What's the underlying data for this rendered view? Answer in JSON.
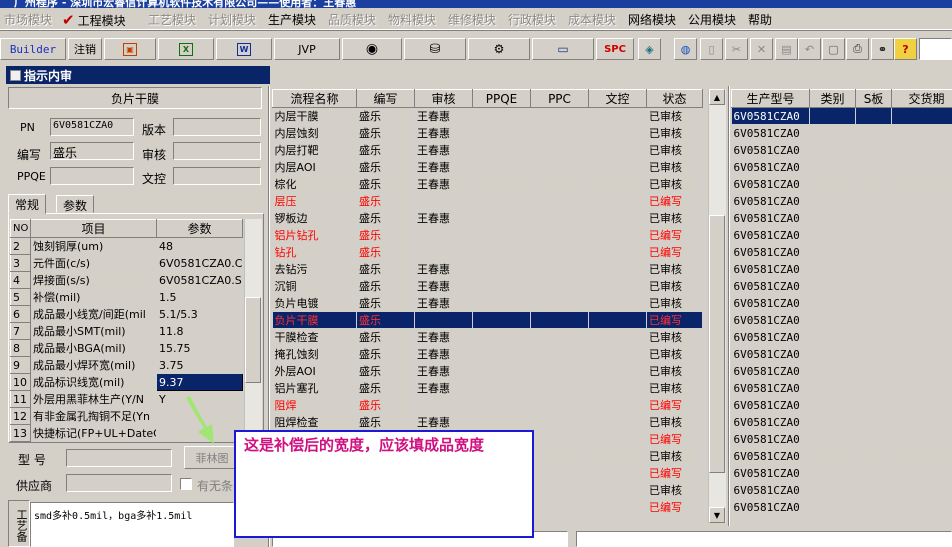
{
  "window": {
    "title": "广州程序 - 深圳市宏睿信计算机软件技术有限公司——使用者：王春惠"
  },
  "menu": [
    {
      "label": "市场模块",
      "enabled": false
    },
    {
      "label": "工程模块",
      "enabled": true,
      "checked": true
    },
    {
      "label": "工艺模块",
      "enabled": false
    },
    {
      "label": "计划模块",
      "enabled": false
    },
    {
      "label": "生产模块",
      "enabled": true
    },
    {
      "label": "品质模块",
      "enabled": false
    },
    {
      "label": "物料模块",
      "enabled": false
    },
    {
      "label": "维修模块",
      "enabled": false
    },
    {
      "label": "行政模块",
      "enabled": false
    },
    {
      "label": "成本模块",
      "enabled": false
    },
    {
      "label": "网络模块",
      "enabled": true
    },
    {
      "label": "公用模块",
      "enabled": true
    },
    {
      "label": "帮助",
      "enabled": true
    }
  ],
  "toolbar": {
    "builder_label": "Builder",
    "logout_label": "注销",
    "jvp_label": "JVP",
    "spc_label": "SPC",
    "icons": [
      "report-icon",
      "excel-icon",
      "word-icon",
      "jvp-icon",
      "eye-icon",
      "database-icon",
      "network-icon",
      "monitor-icon",
      "spc-icon",
      "cube-icon",
      "globe-icon",
      "new-document-icon",
      "cut-icon",
      "delete-icon",
      "save-icon",
      "undo-icon",
      "preview-icon",
      "print-icon",
      "find-icon",
      "help-icon"
    ]
  },
  "panel": {
    "title": "指示内审",
    "process_name": "负片干膜",
    "pn_label": "PN",
    "pn_value": "6V0581CZA0",
    "version_label": "版本",
    "version_value": "",
    "editor_label": "编写",
    "editor_value": "盛乐",
    "reviewer_label": "审核",
    "reviewer_value": "",
    "ppqe_label": "PPQE",
    "ppqe_value": "",
    "doc_control_label": "文控",
    "doc_control_value": ""
  },
  "tabs": [
    {
      "label": "常规",
      "active": true
    },
    {
      "label": "参数",
      "active": false
    }
  ],
  "params_table": {
    "headers": [
      "NO",
      "项目",
      "参数"
    ],
    "rows": [
      {
        "no": "2",
        "item": "蚀刻铜厚(um)",
        "value": "48"
      },
      {
        "no": "3",
        "item": "元件面(c/s)",
        "value": "6V0581CZA0.CS"
      },
      {
        "no": "4",
        "item": "焊接面(s/s)",
        "value": "6V0581CZA0.SS"
      },
      {
        "no": "5",
        "item": "补偿(mil)",
        "value": "1.5"
      },
      {
        "no": "6",
        "item": "成品最小线宽/间距(mil",
        "value": "5.1/5.3"
      },
      {
        "no": "7",
        "item": "成品最小SMT(mil)",
        "value": "11.8"
      },
      {
        "no": "8",
        "item": "成品最小BGA(mil)",
        "value": "15.75"
      },
      {
        "no": "9",
        "item": "成品最小焊环宽(mil)",
        "value": "3.75"
      },
      {
        "no": "10",
        "item": "成品标识线宽(mil)",
        "value": "9.37",
        "editing": true
      },
      {
        "no": "11",
        "item": "外层用黑菲林生产(Y/N",
        "value": "Y"
      },
      {
        "no": "12",
        "item": "有非金属孔掏铜不足(Yn",
        "value": ""
      },
      {
        "no": "13",
        "item": "快捷标记(FP+UL+DateC/",
        "value": ""
      }
    ]
  },
  "bottom_fields": {
    "model_label": "型 号",
    "model_value": "",
    "film_button_label": "菲林图",
    "supplier_label": "供应商",
    "supplier_value": "",
    "no_checkbox_label": "有无条",
    "process_label": "工艺备",
    "notes_value": "smd多补0.5mil，bga多补1.5mil"
  },
  "process_table": {
    "headers": [
      "流程名称",
      "编写",
      "审核",
      "PPQE",
      "PPC",
      "文控",
      "状态"
    ],
    "rows": [
      {
        "name": "内层干膜",
        "editor": "盛乐",
        "reviewer": "王春惠",
        "status": "已审核",
        "red": false
      },
      {
        "name": "内层蚀刻",
        "editor": "盛乐",
        "reviewer": "王春惠",
        "status": "已审核",
        "red": false
      },
      {
        "name": "内层打靶",
        "editor": "盛乐",
        "reviewer": "王春惠",
        "status": "已审核",
        "red": false
      },
      {
        "name": "内层AOI",
        "editor": "盛乐",
        "reviewer": "王春惠",
        "status": "已审核",
        "red": false
      },
      {
        "name": "棕化",
        "editor": "盛乐",
        "reviewer": "王春惠",
        "status": "已审核",
        "red": false
      },
      {
        "name": "层压",
        "editor": "盛乐",
        "reviewer": "",
        "status": "已编写",
        "red": true
      },
      {
        "name": "锣板边",
        "editor": "盛乐",
        "reviewer": "王春惠",
        "status": "已审核",
        "red": false
      },
      {
        "name": "铝片钻孔",
        "editor": "盛乐",
        "reviewer": "",
        "status": "已编写",
        "red": true
      },
      {
        "name": "钻孔",
        "editor": "盛乐",
        "reviewer": "",
        "status": "已编写",
        "red": true
      },
      {
        "name": "去钻污",
        "editor": "盛乐",
        "reviewer": "王春惠",
        "status": "已审核",
        "red": false
      },
      {
        "name": "沉铜",
        "editor": "盛乐",
        "reviewer": "王春惠",
        "status": "已审核",
        "red": false
      },
      {
        "name": "负片电镀",
        "editor": "盛乐",
        "reviewer": "王春惠",
        "status": "已审核",
        "red": false
      },
      {
        "name": "负片干膜",
        "editor": "盛乐",
        "reviewer": "",
        "status": "已编写",
        "red": true,
        "selected": true
      },
      {
        "name": "干膜检查",
        "editor": "盛乐",
        "reviewer": "王春惠",
        "status": "已审核",
        "red": false
      },
      {
        "name": "掩孔蚀刻",
        "editor": "盛乐",
        "reviewer": "王春惠",
        "status": "已审核",
        "red": false
      },
      {
        "name": "外层AOI",
        "editor": "盛乐",
        "reviewer": "王春惠",
        "status": "已审核",
        "red": false
      },
      {
        "name": "铝片塞孔",
        "editor": "盛乐",
        "reviewer": "王春惠",
        "status": "已审核",
        "red": false
      },
      {
        "name": "阻焊",
        "editor": "盛乐",
        "reviewer": "",
        "status": "已编写",
        "red": true
      },
      {
        "name": "阻焊检查",
        "editor": "盛乐",
        "reviewer": "王春惠",
        "status": "已审核",
        "red": false
      },
      {
        "name": "",
        "editor": "",
        "reviewer": "",
        "status": "已编写",
        "red": true
      },
      {
        "name": "",
        "editor": "",
        "reviewer": "",
        "status": "已审核",
        "red": false
      },
      {
        "name": "",
        "editor": "",
        "reviewer": "",
        "status": "已编写",
        "red": true
      },
      {
        "name": "",
        "editor": "",
        "reviewer": "",
        "status": "已审核",
        "red": false
      },
      {
        "name": "",
        "editor": "",
        "reviewer": "",
        "status": "已编写",
        "red": true
      }
    ]
  },
  "model_table": {
    "headers": [
      "生产型号",
      "类别",
      "S板",
      "交货期"
    ],
    "row_value": "6V0581CZA0",
    "row_count": 24
  },
  "annotation": {
    "text": "这是补偿后的宽度，应该填成品宽度"
  },
  "colors": {
    "title_bg": "#0a2468",
    "selection_bg": "#0a246a",
    "status_red": "#ff0000",
    "annotation_border": "#1a1ad6",
    "annotation_text": "#d01080",
    "arrow": "#9be86a"
  }
}
